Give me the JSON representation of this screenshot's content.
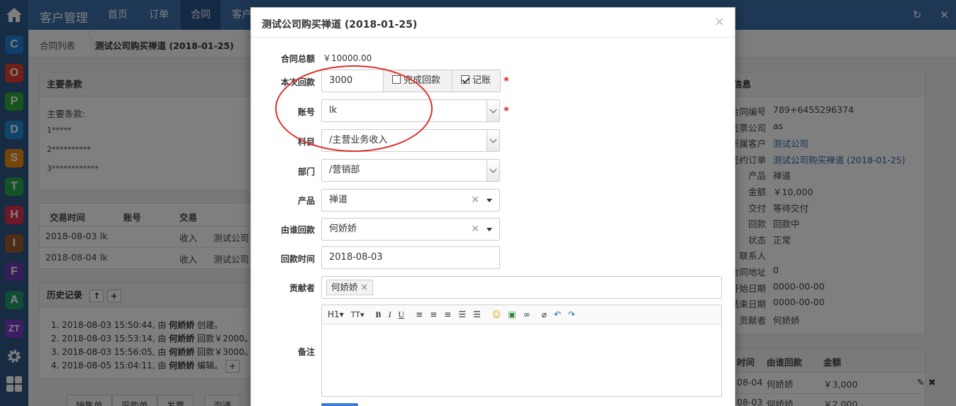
{
  "header": {
    "brand": "客户管理",
    "nav": [
      {
        "label": "首页"
      },
      {
        "label": "订单"
      },
      {
        "label": "合同"
      },
      {
        "label": "客户"
      }
    ],
    "active_nav": "合同",
    "home_icon": "home-icon",
    "refresh_icon": "refresh-icon",
    "close_icon": "close-icon"
  },
  "leftbar": {
    "apps": [
      {
        "letter": "C",
        "color": "#1f7fd6"
      },
      {
        "letter": "O",
        "color": "#e0402c"
      },
      {
        "letter": "P",
        "color": "#2eab3b"
      },
      {
        "letter": "D",
        "color": "#1f8ad6"
      },
      {
        "letter": "S",
        "color": "#f18a12"
      },
      {
        "letter": "T",
        "color": "#26a64a"
      },
      {
        "letter": "H",
        "color": "#e2314f"
      },
      {
        "letter": "I",
        "color": "#9b5a2c"
      },
      {
        "letter": "F",
        "color": "#6b3fb5"
      },
      {
        "letter": "A",
        "color": "#1f9a6b"
      },
      {
        "letter": "ZT",
        "color": "#7a3bc9"
      }
    ]
  },
  "breadcrumb": {
    "root": "合同列表",
    "current": "测试公司购买禅道 (2018-01-25)"
  },
  "main_terms": {
    "title": "主要条款",
    "label": "主要条款:",
    "lines": [
      "1*****",
      "2**********",
      "3************"
    ]
  },
  "transactions": {
    "headers": [
      "交易时间",
      "账号",
      "交易"
    ],
    "rows": [
      {
        "date": "2018-08-03",
        "account": "lk",
        "type": "收入",
        "company": "测试公司"
      },
      {
        "date": "2018-08-04",
        "account": "lk",
        "type": "收入",
        "company": "测试公司"
      }
    ]
  },
  "history": {
    "title": "历史记录",
    "entries": [
      {
        "prefix": "1. 2018-08-03 15:50:44, 由 ",
        "user": "何娇娇",
        "action": " 创建。"
      },
      {
        "prefix": "2. 2018-08-03 15:53:14, 由 ",
        "user": "何娇娇",
        "action": " 回款￥2000。"
      },
      {
        "prefix": "3. 2018-08-03 15:56:05, 由 ",
        "user": "何娇娇",
        "action": " 回款￥3000。"
      },
      {
        "prefix": "4. 2018-08-05 15:04:11, 由 ",
        "user": "何娇娇",
        "action": " 编辑。"
      }
    ]
  },
  "bottom_buttons": [
    "销售单",
    "采购单",
    "发票",
    "沟通"
  ],
  "basic_info": {
    "title": "信息",
    "rows": [
      {
        "label": "合同编号",
        "value": "789+6455296374"
      },
      {
        "label": "签票公司",
        "value": "as"
      },
      {
        "label": "所属客户",
        "value": "测试公司"
      },
      {
        "label": "签约订单",
        "value": "测试公司购买禅道 (2018-01-25)"
      },
      {
        "label": "产品",
        "value": "禅道"
      },
      {
        "label": "金额",
        "value": "￥10,000"
      },
      {
        "label": "交付",
        "value": "等待交付"
      },
      {
        "label": "回款",
        "value": "回款中"
      },
      {
        "label": "状态",
        "value": "正常"
      },
      {
        "label": "联系人",
        "value": ""
      },
      {
        "label": "合同地址",
        "value": "0"
      },
      {
        "label": "开始日期",
        "value": "0000-00-00"
      },
      {
        "label": "结束日期",
        "value": "0000-00-00"
      },
      {
        "label": "贡献者",
        "value": "何娇娇"
      }
    ]
  },
  "returns": {
    "headers": [
      "时间",
      "由谁回款",
      "金额"
    ],
    "rows": [
      {
        "date": "08-04",
        "by": "何娇娇",
        "amount": "￥3,000"
      },
      {
        "date": "08-03",
        "by": "何娇娇",
        "amount": "￥2,000"
      }
    ]
  },
  "modal": {
    "title": "测试公司购买禅道 (2018-01-25)",
    "close": "×",
    "total_label": "合同总额",
    "total_value": "￥10000.00",
    "payment_label": "本次回款",
    "payment_value": "3000",
    "finish_label": "完成回款",
    "finish_checked": false,
    "book_label": "记账",
    "book_checked": true,
    "account_label": "账号",
    "account_value": "lk",
    "subject_label": "科目",
    "subject_value": "/主营业务收入",
    "dept_label": "部门",
    "dept_value": "/营销部",
    "product_label": "产品",
    "product_value": "禅道",
    "payer_label": "由谁回款",
    "payer_value": "何娇娇",
    "date_label": "回款时间",
    "date_value": "2018-08-03",
    "contributor_label": "贡献者",
    "contributor_tag": "何娇娇",
    "note_label": "备注",
    "editor_toolbar": [
      "H1",
      "TT",
      "B",
      "I",
      "U"
    ],
    "required_mark": "*"
  },
  "colors": {
    "topbar": "#3a6ea9",
    "leftbar": "#2e5684",
    "link": "#2f64a8",
    "annotation": "#e0302a",
    "required": "#d9251d"
  }
}
